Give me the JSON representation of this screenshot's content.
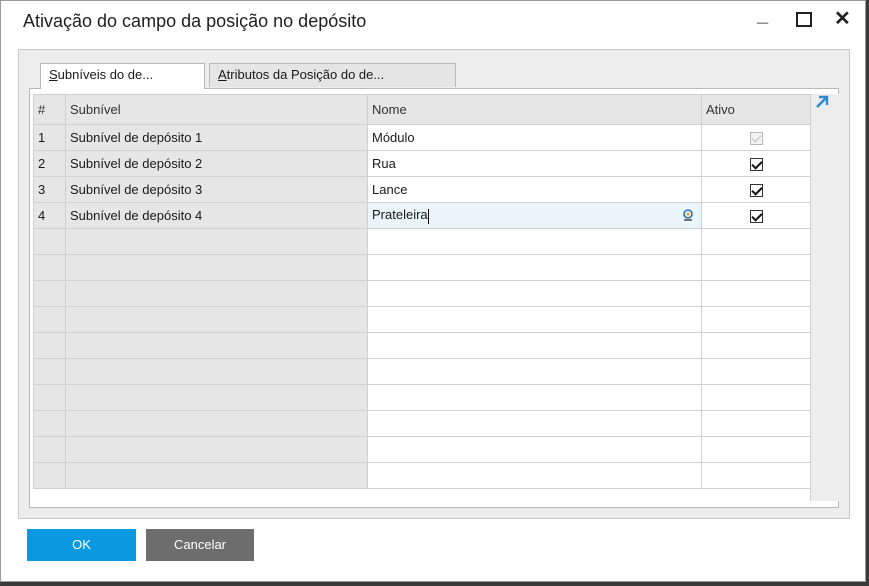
{
  "window": {
    "title": "Ativação do campo da posição no depósito"
  },
  "tabs": [
    {
      "label_first": "S",
      "label_rest": "ubníveis do de...",
      "active": true
    },
    {
      "label_first": "A",
      "label_rest": "tributos da Posição do de...",
      "active": false
    }
  ],
  "grid": {
    "headers": {
      "num": "#",
      "subnivel": "Subnível",
      "nome": "Nome",
      "ativo": "Ativo"
    },
    "rows": [
      {
        "num": "1",
        "subnivel": "Subnível de depósito 1",
        "nome": "Módulo",
        "ativo": true,
        "ativo_enabled": false
      },
      {
        "num": "2",
        "subnivel": "Subnível de depósito 2",
        "nome": "Rua",
        "ativo": true,
        "ativo_enabled": true
      },
      {
        "num": "3",
        "subnivel": "Subnível de depósito 3",
        "nome": "Lance",
        "ativo": true,
        "ativo_enabled": true
      },
      {
        "num": "4",
        "subnivel": "Subnível de depósito 4",
        "nome": "Prateleira",
        "ativo": true,
        "ativo_enabled": true
      }
    ],
    "empty_rows": 10
  },
  "buttons": {
    "ok": "OK",
    "cancel": "Cancelar"
  },
  "icons": {
    "expand": "expand-arrow-icon",
    "lookup": "lookup-icon"
  },
  "colors": {
    "ok_button": "#0a99e0",
    "cancel_button": "#6d6d6d",
    "expand_arrow": "#2a8ad4"
  }
}
